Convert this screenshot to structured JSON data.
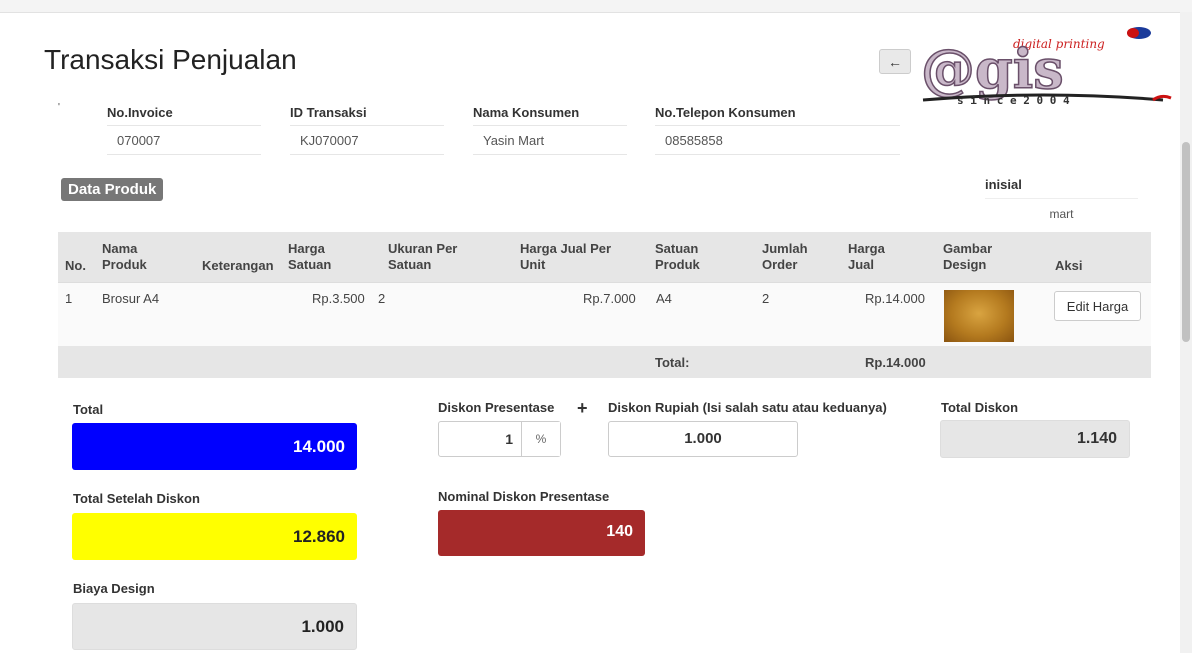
{
  "page": {
    "title": "Transaksi Penjualan",
    "tick": "'"
  },
  "logo": {
    "top_text": "digital printing",
    "letters": "@gis",
    "since": "s i n c e  2 0 0 4"
  },
  "info": {
    "invoice": {
      "label": "No.Invoice",
      "value": "070007"
    },
    "transaksi": {
      "label": "ID Transaksi",
      "value": "KJ070007"
    },
    "konsumen": {
      "label": "Nama Konsumen",
      "value": "Yasin Mart"
    },
    "telepon": {
      "label": "No.Telepon Konsumen",
      "value": "08585858"
    }
  },
  "section": {
    "title": "Data Produk"
  },
  "inisial": {
    "label": "inisial",
    "value": "mart"
  },
  "table": {
    "headers": {
      "no": "No.",
      "nama1": "Nama",
      "nama2": "Produk",
      "ket": "Keterangan",
      "harga1": "Harga",
      "harga2": "Satuan",
      "ukuran1": "Ukuran Per",
      "ukuran2": "Satuan",
      "hju1": "Harga Jual Per",
      "hju2": "Unit",
      "satuan1": "Satuan",
      "satuan2": "Produk",
      "jumlah1": "Jumlah",
      "jumlah2": "Order",
      "hjual1": "Harga",
      "hjual2": "Jual",
      "gambar1": "Gambar",
      "gambar2": "Design",
      "aksi": "Aksi"
    },
    "row": {
      "no": "1",
      "nama": "Brosur A4",
      "keterangan": "",
      "harga_satuan": "Rp.3.500",
      "ukuran": "2",
      "harga_jual_unit": "Rp.7.000",
      "satuan": "A4",
      "jumlah": "2",
      "harga_jual": "Rp.14.000",
      "edit_label": "Edit Harga"
    },
    "footer": {
      "label": "Total:",
      "value": "Rp.14.000"
    }
  },
  "summary": {
    "total_label": "Total",
    "total_value": "14.000",
    "after_label": "Total Setelah Diskon",
    "after_value": "12.860",
    "biaya_label": "Biaya Design",
    "biaya_value": "1.000",
    "diskon_pct_label": "Diskon Presentase",
    "diskon_pct_value": "1",
    "pct_symbol": "%",
    "plus": "+",
    "diskon_rp_label": "Diskon Rupiah (Isi salah satu atau keduanya)",
    "diskon_rp_value": "1.000",
    "total_diskon_label": "Total Diskon",
    "total_diskon_value": "1.140",
    "nominal_label": "Nominal Diskon Presentase",
    "nominal_value": "140"
  },
  "colors": {
    "total_bg": "#0000ff",
    "after_bg": "#ffff00",
    "nominal_bg": "#a52a2a",
    "badge_bg": "#777777"
  }
}
